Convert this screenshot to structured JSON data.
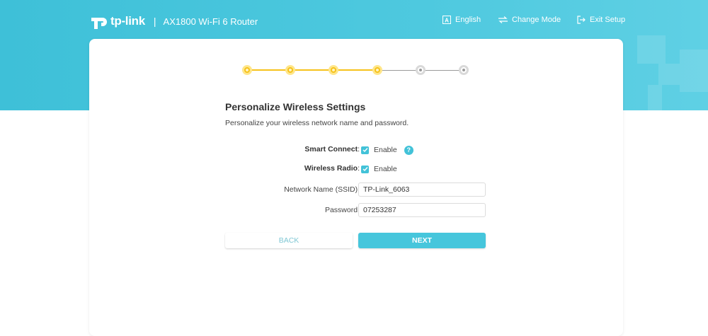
{
  "header": {
    "brand": "tp-link",
    "separator": "|",
    "model": "AX1800 Wi-Fi 6 Router",
    "nav": [
      {
        "label": "English",
        "icon": "language-icon"
      },
      {
        "label": "Change Mode",
        "icon": "change-mode-icon"
      },
      {
        "label": "Exit Setup",
        "icon": "exit-icon"
      }
    ]
  },
  "stepper": {
    "total_steps": 6,
    "completed_steps": 4,
    "active_color": "#f6c21b",
    "inactive_color": "#9a9a9a"
  },
  "page": {
    "title": "Personalize Wireless Settings",
    "subtitle": "Personalize your wireless network name and password."
  },
  "form": {
    "smart_connect": {
      "label": "Smart Connect",
      "colon": ":",
      "checkbox_label": "Enable",
      "checked": true,
      "help_icon": "help-icon"
    },
    "wireless_radio": {
      "label": "Wireless Radio",
      "colon": ":",
      "checkbox_label": "Enable",
      "checked": true
    },
    "ssid": {
      "label": "Network Name (SSID):",
      "value": "TP-Link_6063"
    },
    "password": {
      "label": "Password:",
      "value": "07253287"
    }
  },
  "buttons": {
    "back": "BACK",
    "next": "NEXT"
  },
  "colors": {
    "accent": "#42c2d8",
    "banner": "#4ec9df"
  }
}
